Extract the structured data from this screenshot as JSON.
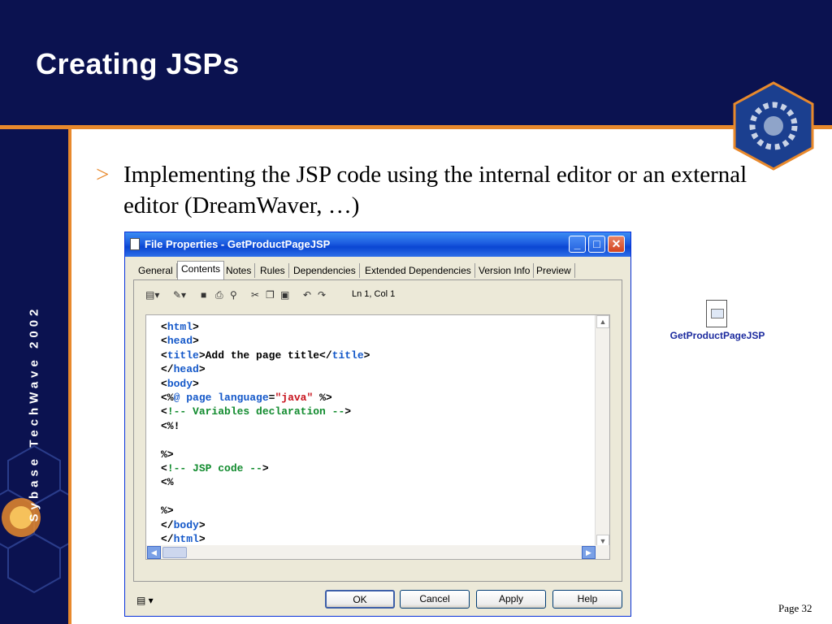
{
  "slide": {
    "title": "Creating JSPs",
    "brand": "Sybase TechWave 2002",
    "bullet_mark": ">",
    "bullet_text": "Implementing the JSP code using the internal editor or an external editor (DreamWaver, …)",
    "page": "Page 32"
  },
  "dialog": {
    "title": "File Properties - GetProductPageJSP",
    "tabs": [
      "General",
      "Contents",
      "Notes",
      "Rules",
      "Dependencies",
      "Extended Dependencies",
      "Version Info",
      "Preview"
    ],
    "active_tab": "Contents",
    "cursor_position": "Ln 1, Col 1",
    "buttons": {
      "ok": "OK",
      "cancel": "Cancel",
      "apply": "Apply",
      "help": "Help"
    },
    "code_lines": [
      "<html>",
      "<head>",
      "<title>Add the page title</title>",
      "</head>",
      "<body>",
      "<%@ page language=\"java\" %>",
      "<!-- Variables declaration -->",
      "<%!",
      "",
      "%>",
      "<!-- JSP code -->",
      "<%",
      "",
      "%>",
      "</body>",
      "</html>"
    ]
  },
  "file_icon": {
    "label": "GetProductPageJSP"
  },
  "colors": {
    "navy": "#0b1250",
    "orange": "#e8892c",
    "xp_blue": "#0a46d2",
    "code_keyword": "#1458c9",
    "code_string": "#c8141e",
    "code_comment": "#118b2e"
  }
}
